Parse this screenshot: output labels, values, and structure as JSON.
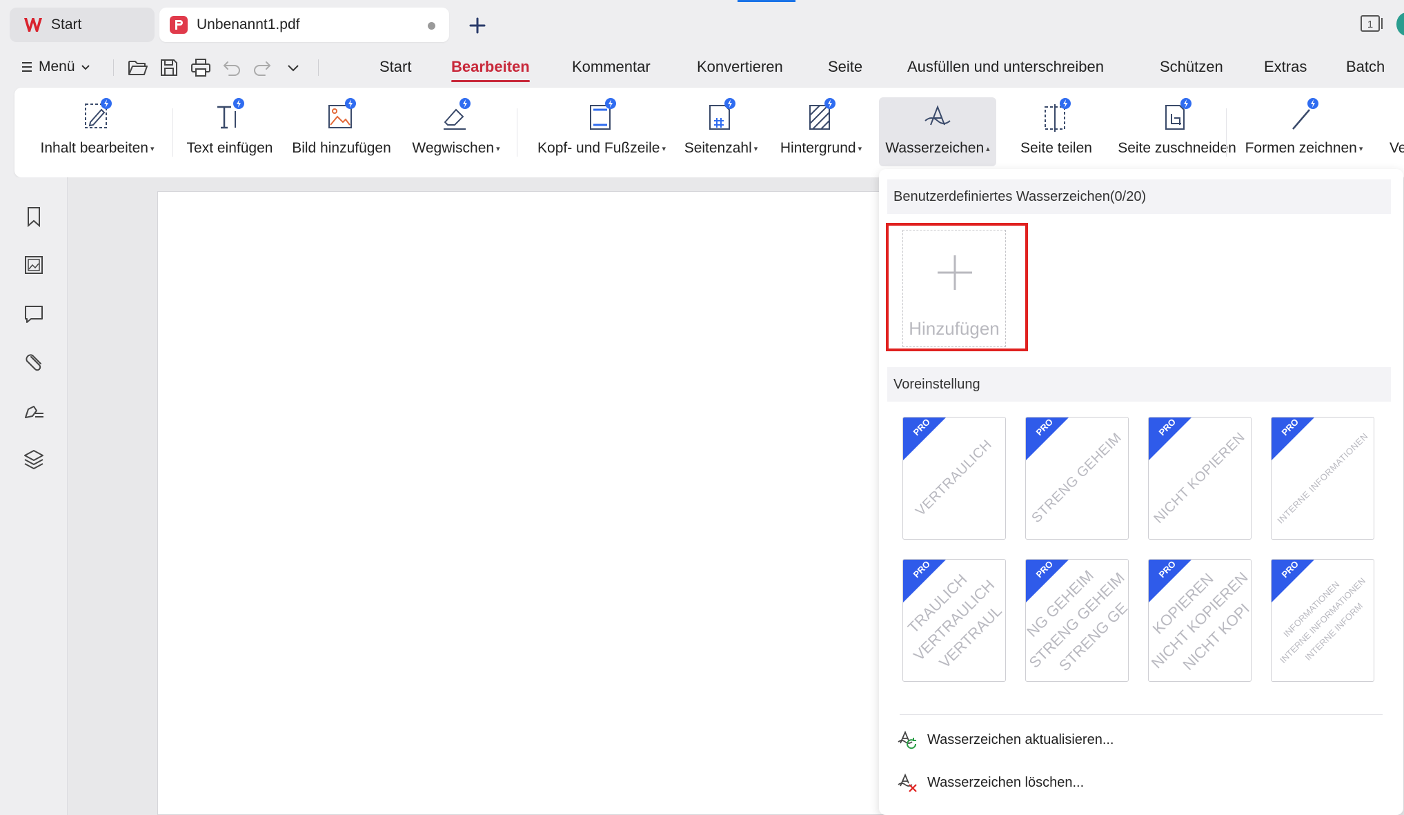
{
  "tabs": {
    "home_label": "Start",
    "document_label": "Unbenannt1.pdf"
  },
  "window": {
    "page_count_badge": "1"
  },
  "menu": {
    "menu_label": "Menü"
  },
  "ribbon_tabs": [
    {
      "label": "Start",
      "active": false
    },
    {
      "label": "Bearbeiten",
      "active": true
    },
    {
      "label": "Kommentar",
      "active": false
    },
    {
      "label": "Konvertieren",
      "active": false
    },
    {
      "label": "Seite",
      "active": false
    },
    {
      "label": "Ausfüllen und unterschreiben",
      "active": false
    },
    {
      "label": "Schützen",
      "active": false
    },
    {
      "label": "Extras",
      "active": false
    },
    {
      "label": "Batch",
      "active": false
    }
  ],
  "ribbon_buttons": {
    "edit_content": "Inhalt bearbeiten",
    "insert_text": "Text einfügen",
    "add_image": "Bild hinzufügen",
    "erase": "Wegwischen",
    "header_footer": "Kopf- und Fußzeile",
    "page_number": "Seitenzahl",
    "background": "Hintergrund",
    "watermark": "Wasserzeichen",
    "split_page": "Seite teilen",
    "crop_page": "Seite zuschneiden",
    "draw_shapes": "Formen zeichnen",
    "overflow": "Ve"
  },
  "watermark_panel": {
    "custom_header": "Benutzerdefiniertes Wasserzeichen(0/20)",
    "add_label": "Hinzufügen",
    "preset_header": "Voreinstellung",
    "pro_badge": "PRO",
    "presets": [
      {
        "text": "VERTRAULICH"
      },
      {
        "text": "STRENG GEHEIM"
      },
      {
        "text": "NICHT KOPIEREN"
      },
      {
        "text": "INTERNE INFORMATIONEN"
      }
    ],
    "tiled_presets": [
      {
        "lines": [
          "TRAULICH",
          "VERTRAULICH",
          "VERTRAUL"
        ]
      },
      {
        "lines": [
          "NG GEHEIM",
          "STRENG GEHEIM",
          "STRENG GE"
        ]
      },
      {
        "lines": [
          "KOPIEREN",
          "NICHT KOPIEREN",
          "NICHT KOPI"
        ]
      },
      {
        "lines": [
          "INFORMATIONEN",
          "INTERNE INFORMATIONEN",
          "INTERNE INFORM"
        ]
      }
    ],
    "update_action": "Wasserzeichen aktualisieren...",
    "delete_action": "Wasserzeichen löschen..."
  },
  "colors": {
    "accent_red": "#c8283a",
    "highlight_red": "#e0211f",
    "pro_blue": "#2f5bea"
  }
}
